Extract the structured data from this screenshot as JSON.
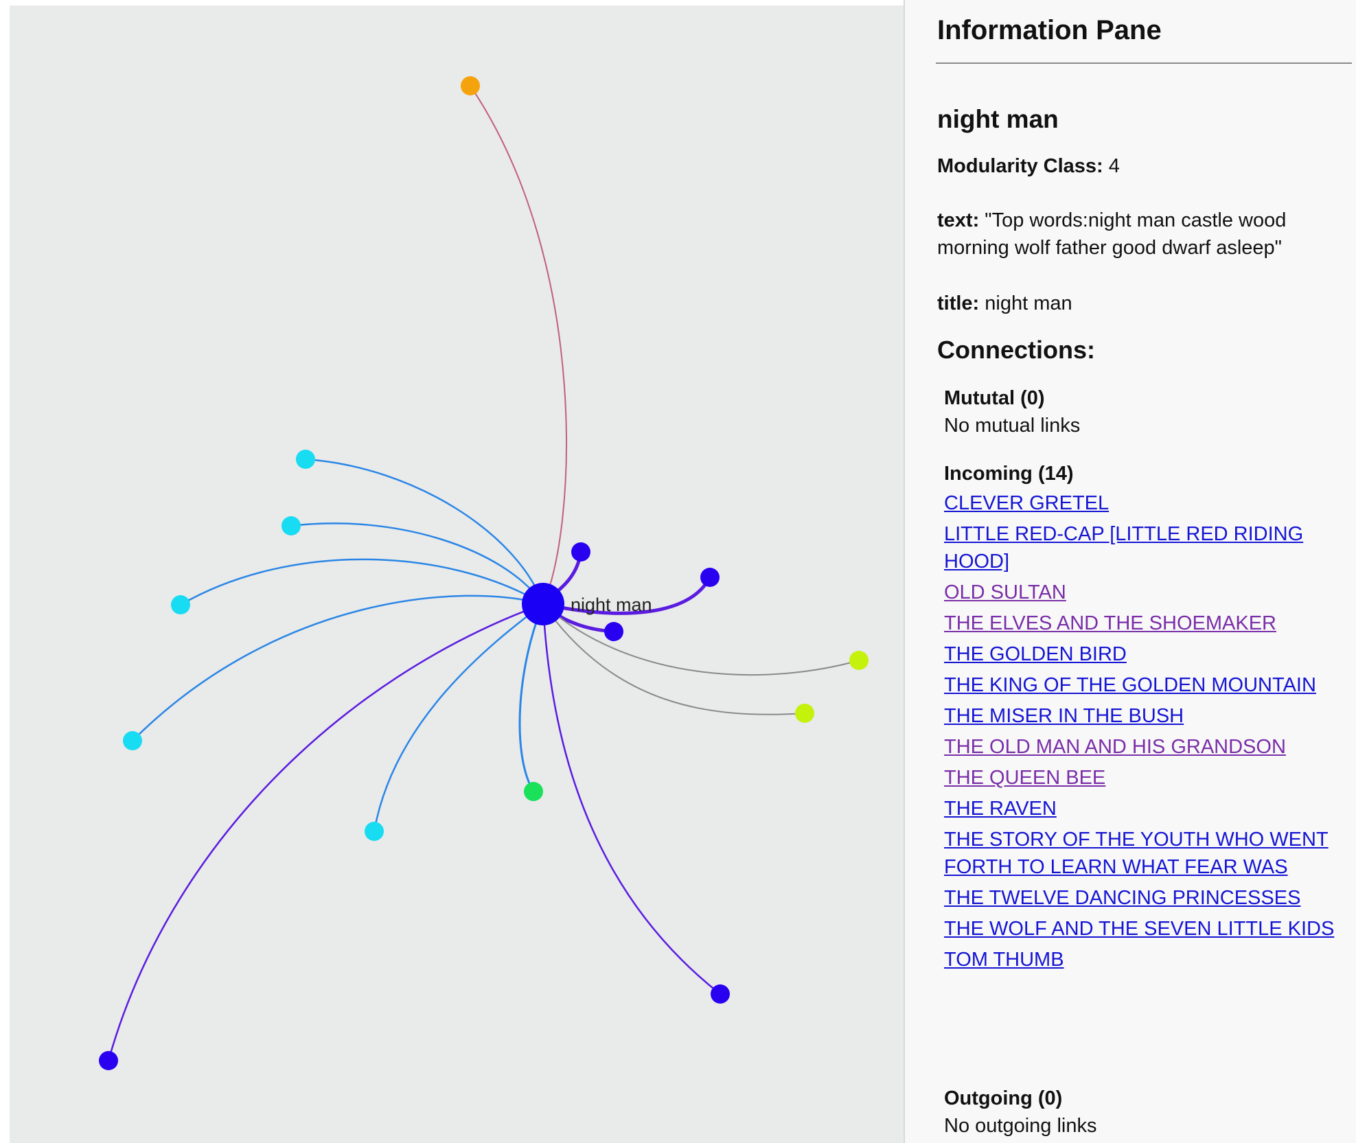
{
  "graph": {
    "center_label": "night man",
    "colors": {
      "center": "#1a00f5",
      "blue": "#2a00f0",
      "cyan": "#17dcf2",
      "orange": "#f5a30d",
      "yellow": "#c4f20d",
      "green": "#1ae05a",
      "edge_blue": "#2a86e6",
      "edge_purple": "#5a1ce0",
      "edge_red": "#c0607a",
      "edge_gray": "#8a8a8a"
    }
  },
  "info_pane": {
    "title": "Information Pane",
    "node_name": "night man",
    "modularity_label": "Modularity Class:",
    "modularity_value": "4",
    "text_label": "text:",
    "text_value": "\"Top words:night man castle wood morning wolf father good dwarf asleep\"",
    "title_label": "title:",
    "title_value": "night man",
    "connections_heading": "Connections:",
    "mutual": {
      "heading": "Mututal (0)",
      "empty": "No mutual links"
    },
    "incoming": {
      "heading": "Incoming (14)",
      "links": [
        {
          "label": "CLEVER GRETEL",
          "visited": false
        },
        {
          "label": "LITTLE RED-CAP [LITTLE RED RIDING HOOD]",
          "visited": false
        },
        {
          "label": "OLD SULTAN",
          "visited": true
        },
        {
          "label": "THE ELVES AND THE SHOEMAKER",
          "visited": true
        },
        {
          "label": "THE GOLDEN BIRD",
          "visited": false
        },
        {
          "label": "THE KING OF THE GOLDEN MOUNTAIN",
          "visited": false
        },
        {
          "label": "THE MISER IN THE BUSH",
          "visited": false
        },
        {
          "label": "THE OLD MAN AND HIS GRANDSON",
          "visited": true
        },
        {
          "label": "THE QUEEN BEE",
          "visited": true
        },
        {
          "label": "THE RAVEN",
          "visited": false
        },
        {
          "label": "THE STORY OF THE YOUTH WHO WENT FORTH TO LEARN WHAT FEAR WAS",
          "visited": false
        },
        {
          "label": "THE TWELVE DANCING PRINCESSES",
          "visited": false
        },
        {
          "label": "THE WOLF AND THE SEVEN LITTLE KIDS",
          "visited": false
        },
        {
          "label": "TOM THUMB",
          "visited": false
        }
      ]
    },
    "outgoing": {
      "heading": "Outgoing (0)",
      "empty": "No outgoing links"
    }
  }
}
